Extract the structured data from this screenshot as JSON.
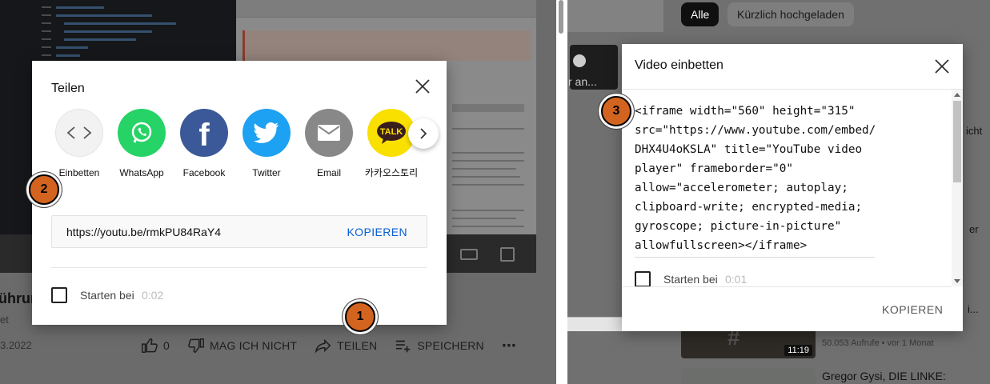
{
  "left": {
    "video_title_fragment": "ührun",
    "channel_fragment": "et",
    "date_fragment": "3.2022",
    "actions": {
      "like_count": "0",
      "dislike_label": "MAG ICH NICHT",
      "share_label": "TEILEN",
      "save_label": "SPEICHERN",
      "more_label": "⋯"
    },
    "share_dialog": {
      "title": "Teilen",
      "options": [
        {
          "label": "Einbetten",
          "icon": "embed-code-icon",
          "color": "#f2f2f2"
        },
        {
          "label": "WhatsApp",
          "icon": "whatsapp-icon",
          "color": "#25d366"
        },
        {
          "label": "Facebook",
          "icon": "facebook-icon",
          "color": "#3b5998"
        },
        {
          "label": "Twitter",
          "icon": "twitter-icon",
          "color": "#1da1f2"
        },
        {
          "label": "Email",
          "icon": "email-icon",
          "color": "#888888"
        },
        {
          "label": "카카오스토리",
          "icon": "kakaotalk-icon",
          "color": "#f9e000"
        }
      ],
      "url": "https://youtu.be/rmkPU84RaY4",
      "copy_label": "KOPIEREN",
      "start_at_label": "Starten bei",
      "start_at_time": "0:02"
    }
  },
  "right": {
    "chips": [
      {
        "label": "Alle",
        "active": true
      },
      {
        "label": "Kürzlich hochgeladen",
        "active": false
      }
    ],
    "thumb_fragment": "r an...",
    "side_fragments": [
      "icht",
      "er",
      "i..."
    ],
    "recs": [
      {
        "duration": "11:19",
        "meta": "50.053 Aufrufe • vor 1 Monat"
      },
      {
        "title": "Gregor Gysi, DIE LINKE:"
      }
    ],
    "embed_dialog": {
      "title": "Video einbetten",
      "code": "<iframe width=\"560\" height=\"315\"\nsrc=\"https://www.youtube.com/embed/\nDHX4U4oKSLA\" title=\"YouTube video\nplayer\" frameborder=\"0\"\nallow=\"accelerometer; autoplay;\nclipboard-write; encrypted-media;\ngyroscope; picture-in-picture\"\nallowfullscreen></iframe>",
      "start_at_label": "Starten bei",
      "start_at_time": "0:01",
      "copy_label": "KOPIEREN"
    }
  },
  "markers": [
    "1",
    "2",
    "3"
  ],
  "colors": {
    "accent_blue": "#065fd4",
    "marker_orange": "#d2641f"
  }
}
